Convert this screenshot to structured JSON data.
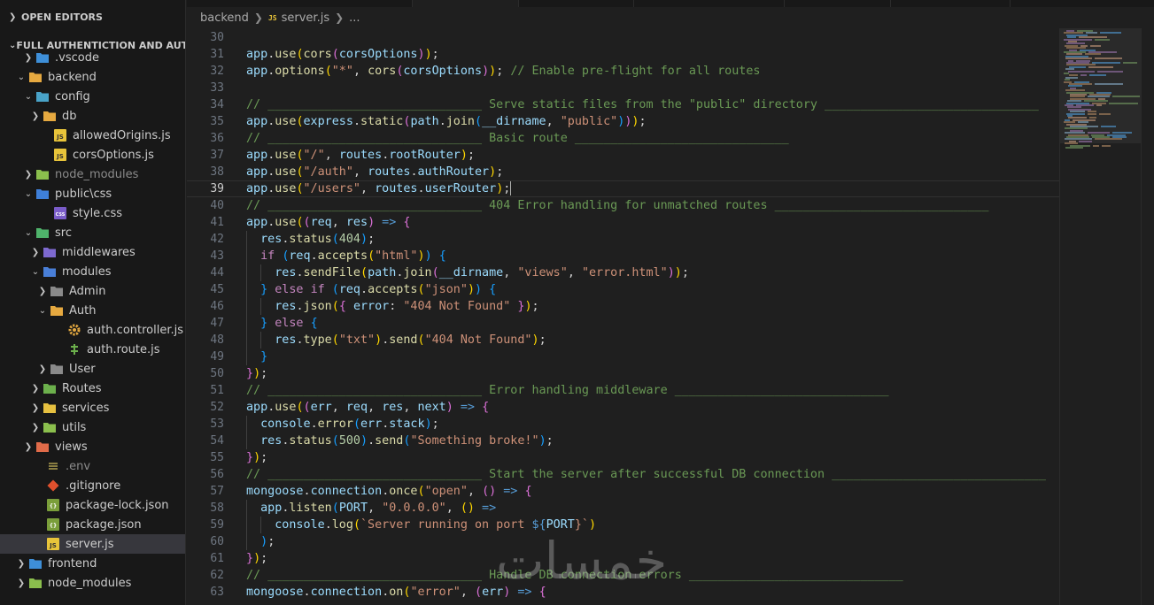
{
  "explorer": {
    "open_editors_label": "OPEN EDITORS",
    "project_label": "FULL AUTHENTICTION AND AUT...",
    "tree": [
      {
        "label": "vscode_item",
        "text": ".vscode",
        "name": "tree-item-vscode",
        "icon": "folder-vscode-icon"
      },
      {
        "text": "backend",
        "name": "tree-item-backend"
      },
      {
        "text": "config",
        "name": "tree-item-config"
      },
      {
        "text": "db",
        "name": "tree-item-db"
      },
      {
        "text": "allowedOrigins.js",
        "name": "tree-item-allowed-origins"
      },
      {
        "text": "corsOptions.js",
        "name": "tree-item-cors-options"
      },
      {
        "text": "node_modules",
        "name": "tree-item-backend-node-modules"
      },
      {
        "text": "public\\css",
        "name": "tree-item-public-css"
      },
      {
        "text": "style.css",
        "name": "tree-item-style-css"
      },
      {
        "text": "src",
        "name": "tree-item-src"
      },
      {
        "text": "middlewares",
        "name": "tree-item-middlewares"
      },
      {
        "text": "modules",
        "name": "tree-item-modules"
      },
      {
        "text": "Admin",
        "name": "tree-item-admin"
      },
      {
        "text": "Auth",
        "name": "tree-item-auth"
      },
      {
        "text": "auth.controller.js",
        "name": "tree-item-auth-controller"
      },
      {
        "text": "auth.route.js",
        "name": "tree-item-auth-route"
      },
      {
        "text": "User",
        "name": "tree-item-user"
      },
      {
        "text": "Routes",
        "name": "tree-item-routes"
      },
      {
        "text": "services",
        "name": "tree-item-services"
      },
      {
        "text": "utils",
        "name": "tree-item-utils"
      },
      {
        "text": "views",
        "name": "tree-item-views"
      },
      {
        "text": ".env",
        "name": "tree-item-env"
      },
      {
        "text": ".gitignore",
        "name": "tree-item-gitignore"
      },
      {
        "text": "package-lock.json",
        "name": "tree-item-package-lock"
      },
      {
        "text": "package.json",
        "name": "tree-item-package-json"
      },
      {
        "text": "server.js",
        "name": "tree-item-server-js"
      },
      {
        "text": "frontend",
        "name": "tree-item-frontend"
      },
      {
        "text": "node_modules",
        "name": "tree-item-root-node-modules"
      }
    ]
  },
  "breadcrumbs": {
    "folder": "backend",
    "file_badge": "JS",
    "file": "server.js",
    "symbol": "..."
  },
  "editor": {
    "current_line": 39,
    "line_numbers": [
      "30",
      "31",
      "32",
      "33",
      "34",
      "35",
      "36",
      "37",
      "38",
      "39",
      "40",
      "41",
      "42",
      "43",
      "44",
      "45",
      "46",
      "47",
      "48",
      "49",
      "50",
      "51",
      "52",
      "53",
      "54",
      "55",
      "56",
      "57",
      "58",
      "59",
      "60",
      "61",
      "62",
      "63"
    ],
    "text": {
      "app": "app",
      "use": "use",
      "options": "options",
      "cors": "cors",
      "corsOptions": "corsOptions",
      "star": "\"*\"",
      "comment_preflight": "// Enable pre-flight for all routes",
      "comment_static": "// ______________________________ Serve static files from the \"public\" directory ______________________________",
      "express": "express",
      "static": "static",
      "path": "path",
      "join": "join",
      "dirname": "__dirname",
      "public_str": "\"public\"",
      "comment_basic": "// ______________________________ Basic route ______________________________",
      "slash": "\"/\"",
      "routes": "routes",
      "rootRouter": "rootRouter",
      "auth_str": "\"/auth\"",
      "authRouter": "authRouter",
      "users_str": "\"/users\"",
      "userRouter": "userRouter",
      "comment_404": "// ______________________________ 404 Error handling for unmatched routes ______________________________",
      "req": "req",
      "res": "res",
      "status": "status",
      "n404": "404",
      "if": "if",
      "else": "else",
      "accepts": "accepts",
      "html_str": "\"html\"",
      "sendFile": "sendFile",
      "views_str": "\"views\"",
      "error_html_str": "\"error.html\"",
      "json_str": "\"json\"",
      "json": "json",
      "error": "error",
      "not_found_str": "\"404 Not Found\"",
      "type": "type",
      "txt_str": "\"txt\"",
      "send": "send",
      "comment_errmw": "// ______________________________ Error handling middleware ______________________________",
      "err": "err",
      "next": "next",
      "console": "console",
      "stack": "stack",
      "n500": "500",
      "broke_str": "\"Something broke!\"",
      "comment_start": "// ______________________________ Start the server after successful DB connection ______________________________",
      "mongoose": "mongoose",
      "connection": "connection",
      "once": "once",
      "open_str": "\"open\"",
      "listen": "listen",
      "PORT": "PORT",
      "host_str": "\"0.0.0.0\"",
      "log": "log",
      "template_start": "`Server running on port ",
      "template_open": "${",
      "template_close": "}`",
      "comment_dberr": "// ______________________________ Handle DB connection errors ______________________________",
      "on": "on",
      "error_str": "\"error\""
    }
  },
  "watermark": "خمسات",
  "colors": {
    "background": "#1f1f1f",
    "sidebar": "#181818",
    "comment": "#6a9955",
    "string": "#ce9178",
    "variable": "#9cdcfe",
    "function": "#dcdcaa",
    "keyword": "#c586c0"
  }
}
